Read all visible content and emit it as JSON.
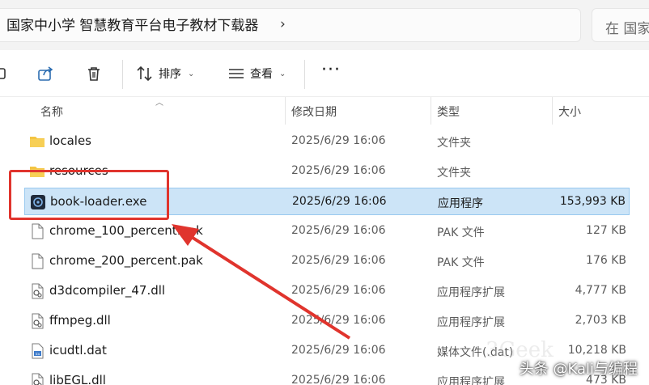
{
  "address_bar": {
    "path": "国家中小学 智慧教育平台电子教材下载器",
    "chevron": "›"
  },
  "search": {
    "placeholder": "在 国家"
  },
  "toolbar": {
    "sort_label": "排序",
    "view_label": "查看",
    "more_label": "···"
  },
  "columns": {
    "name": "名称",
    "date": "修改日期",
    "type": "类型",
    "size": "大小"
  },
  "files": [
    {
      "name": "locales",
      "date": "2025/6/29 16:06",
      "type": "文件夹",
      "size": "",
      "icon": "folder-icon"
    },
    {
      "name": "resources",
      "date": "2025/6/29 16:06",
      "type": "文件夹",
      "size": "",
      "icon": "folder-icon"
    },
    {
      "name": "book-loader.exe",
      "date": "2025/6/29 16:06",
      "type": "应用程序",
      "size": "153,993 KB",
      "icon": "app-icon",
      "selected": true
    },
    {
      "name": "chrome_100_percent.pak",
      "date": "2025/6/29 16:06",
      "type": "PAK 文件",
      "size": "127 KB",
      "icon": "file-icon"
    },
    {
      "name": "chrome_200_percent.pak",
      "date": "2025/6/29 16:06",
      "type": "PAK 文件",
      "size": "176 KB",
      "icon": "file-icon"
    },
    {
      "name": "d3dcompiler_47.dll",
      "date": "2025/6/29 16:06",
      "type": "应用程序扩展",
      "size": "4,777 KB",
      "icon": "dll-icon"
    },
    {
      "name": "ffmpeg.dll",
      "date": "2025/6/29 16:06",
      "type": "应用程序扩展",
      "size": "2,703 KB",
      "icon": "dll-icon"
    },
    {
      "name": "icudtl.dat",
      "date": "2025/6/29 16:06",
      "type": "媒体文件(.dat)",
      "size": "10,218 KB",
      "icon": "dat-icon"
    },
    {
      "name": "libEGL.dll",
      "date": "2025/6/29 16:06",
      "type": "应用程序扩展",
      "size": "473 KB",
      "icon": "dll-icon"
    }
  ],
  "watermark": "头条 @Kali与编程",
  "colors": {
    "selection_bg": "#cce4f7",
    "annotation_red": "#e0342d",
    "folder_yellow": "#f4c542"
  }
}
